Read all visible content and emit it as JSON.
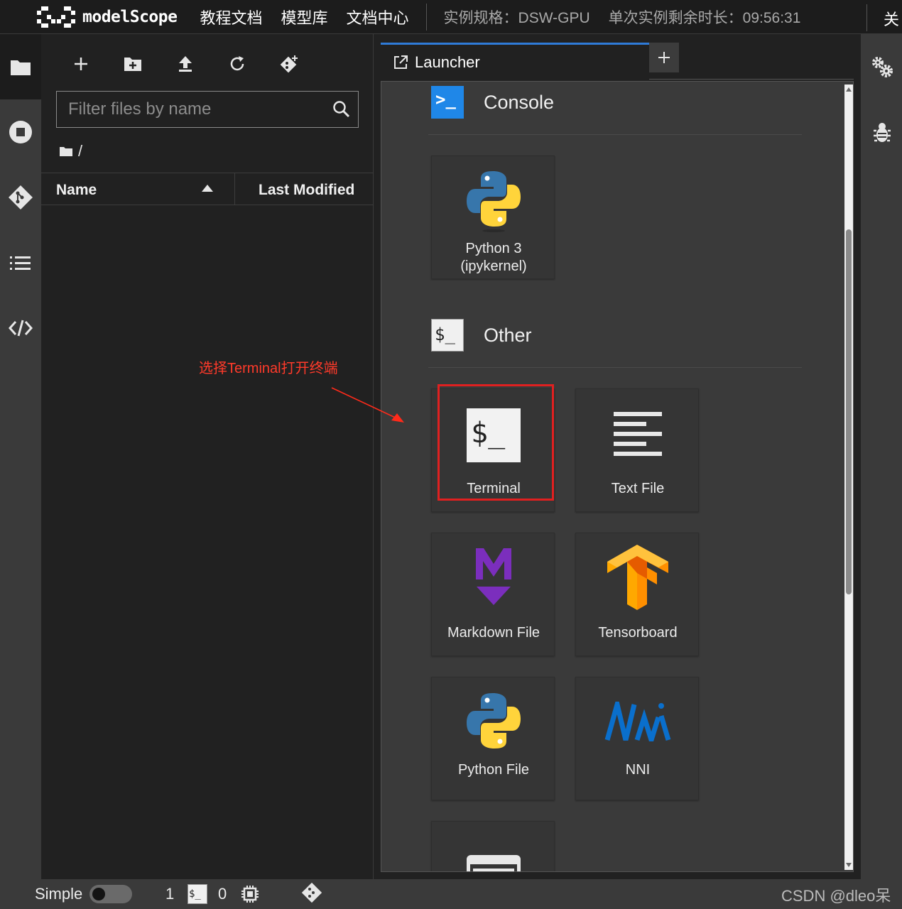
{
  "header": {
    "logo_text": "modelScope",
    "nav": [
      "教程文档",
      "模型库",
      "文档中心"
    ],
    "instance_spec": "实例规格：DSW-GPU",
    "remaining_time": "单次实例剩余时长：09:56:31",
    "close_label": "关"
  },
  "activity_bar": {
    "items": [
      "folder-icon",
      "stop-circle-icon",
      "git-icon",
      "toc-list-icon",
      "code-icon"
    ]
  },
  "file_browser": {
    "toolbar": [
      "new-launcher",
      "new-folder",
      "upload",
      "refresh",
      "git-clone"
    ],
    "filter_placeholder": "Filter files by name",
    "breadcrumb": "/",
    "columns": {
      "name": "Name",
      "modified": "Last Modified"
    }
  },
  "tabs": {
    "launcher_label": "Launcher",
    "add_label": "+"
  },
  "launcher": {
    "console_section": "Console",
    "other_section": "Other",
    "console_cards": [
      {
        "line1": "Python 3",
        "line2": "(ipykernel)"
      }
    ],
    "other_cards": [
      {
        "label": "Terminal"
      },
      {
        "label": "Text File"
      },
      {
        "label": "Markdown File"
      },
      {
        "label": "Tensorboard"
      },
      {
        "label": "Python File"
      },
      {
        "label": "NNI"
      }
    ],
    "terminal_glyph": "$_",
    "other_glyph": "$_",
    "console_glyph": ">_"
  },
  "annotation": "选择Terminal打开终端",
  "statusbar": {
    "mode": "Simple",
    "terminals": "1",
    "kernels": "0",
    "terminal_glyph": "$_"
  },
  "watermark": "CSDN @dleo呆",
  "colors": {
    "accent": "#2f7bd8",
    "highlight": "#e02020",
    "annotation": "#ff3a2a"
  }
}
